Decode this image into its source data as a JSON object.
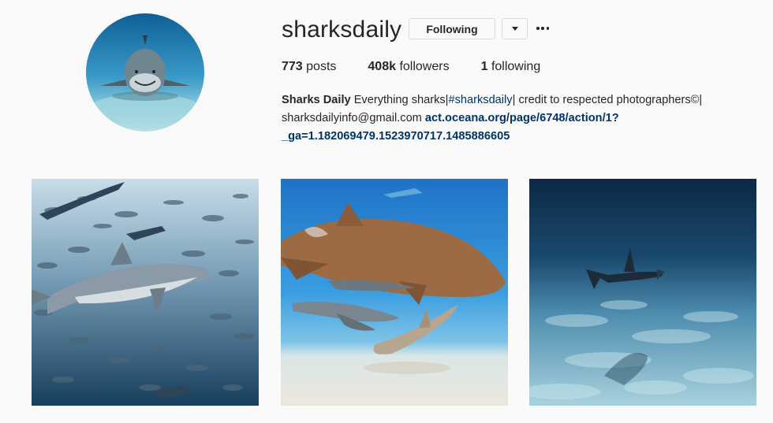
{
  "profile": {
    "username": "sharksdaily",
    "following_button_label": "Following",
    "dropdown_icon": "chevron-down-icon",
    "more_icon": "ellipsis-icon",
    "avatar_icon": "shark-avatar"
  },
  "stats": {
    "posts_count": "773",
    "posts_label": "posts",
    "followers_count": "408k",
    "followers_label": "followers",
    "following_count": "1",
    "following_label": "following"
  },
  "bio": {
    "display_name": "Sharks Daily",
    "text_before_tag": "Everything sharks|",
    "hashtag": "#sharksdaily",
    "text_after_tag": "| credit to respected photographers©|",
    "email": "sharksdailyinfo@gmail.com",
    "link": "act.oceana.org/page/6748/action/1?_ga=1.182069479.1523970717.1485886605"
  },
  "posts": [
    {
      "description": "shark swimming among school of fish"
    },
    {
      "description": "nurse sharks with remoras"
    },
    {
      "description": "hammerhead shark over sandy seabed"
    }
  ],
  "colors": {
    "background": "#fafafa",
    "text": "#262626",
    "link": "#003569",
    "border": "#dbdbdb"
  }
}
